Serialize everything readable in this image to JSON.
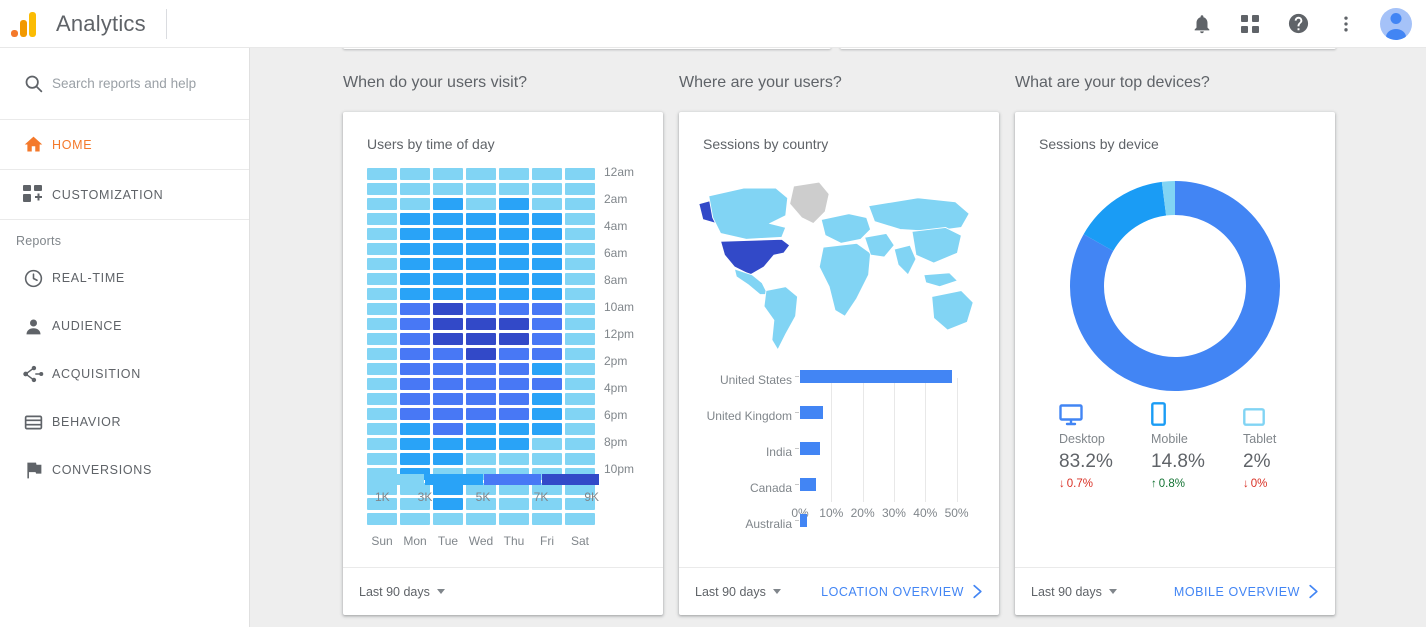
{
  "header": {
    "app_title": "Analytics",
    "logo_name": "google-analytics-logo",
    "icons": [
      {
        "name": "notifications-bell-icon",
        "label": "Notifications"
      },
      {
        "name": "apps-grid-icon",
        "label": "Google apps"
      },
      {
        "name": "help-circle-icon",
        "label": "Help"
      },
      {
        "name": "more-vert-icon",
        "label": "More options"
      },
      {
        "name": "avatar",
        "label": "Account"
      }
    ]
  },
  "sidebar": {
    "search": {
      "placeholder": "Search reports and help",
      "value": "",
      "icon": "search-icon"
    },
    "top_items": [
      {
        "label": "HOME",
        "icon": "home-icon",
        "active": true
      },
      {
        "label": "CUSTOMIZATION",
        "icon": "customization-icon",
        "active": false
      }
    ],
    "section_label": "Reports",
    "items": [
      {
        "label": "REAL-TIME",
        "icon": "clock-icon"
      },
      {
        "label": "AUDIENCE",
        "icon": "person-icon"
      },
      {
        "label": "ACQUISITION",
        "icon": "acquisition-icon"
      },
      {
        "label": "BEHAVIOR",
        "icon": "behavior-icon"
      },
      {
        "label": "CONVERSIONS",
        "icon": "flag-icon"
      }
    ]
  },
  "columns": {
    "header_1": "When do your users visit?",
    "header_2": "Where are your users?",
    "header_3": "What are your top devices?"
  },
  "cards": {
    "time_of_day": {
      "title": "Users by time of day",
      "date_range": "Last 90 days",
      "link": null
    },
    "country": {
      "title": "Sessions by country",
      "date_range": "Last 90 days",
      "link": "LOCATION OVERVIEW"
    },
    "device": {
      "title": "Sessions by device",
      "date_range": "Last 90 days",
      "link": "MOBILE OVERVIEW"
    }
  },
  "colors": {
    "accent_blue": "#4285F4",
    "heat_1": "#81D4F4",
    "heat_2": "#29A3F7",
    "heat_3": "#4878F5",
    "heat_4": "#3249C8",
    "brand_orange": "#F4792B",
    "up_green": "#137333",
    "down_red": "#D93025",
    "page_bg": "#EEEEEE",
    "map_default": "#81D4F4",
    "map_nodata": "#CDCDCD"
  },
  "chart_data": [
    {
      "type": "heatmap",
      "title": "Users by time of day",
      "xlabel": "",
      "ylabel": "",
      "categories": [
        "Sun",
        "Mon",
        "Tue",
        "Wed",
        "Thu",
        "Fri",
        "Sat"
      ],
      "y_tick_labels": [
        "12am",
        "2am",
        "4am",
        "6am",
        "8am",
        "10am",
        "12pm",
        "2pm",
        "4pm",
        "6pm",
        "8pm",
        "10pm"
      ],
      "rows": 24,
      "legend": {
        "bins": [
          "1K",
          "3K",
          "5K",
          "7K",
          "9K"
        ],
        "colors": [
          "#81D4F4",
          "#29A3F7",
          "#4878F5",
          "#3249C8"
        ]
      },
      "levels": [
        [
          1,
          1,
          1,
          1,
          1,
          1,
          1
        ],
        [
          1,
          1,
          1,
          1,
          1,
          1,
          1
        ],
        [
          1,
          1,
          2,
          1,
          2,
          1,
          1
        ],
        [
          1,
          2,
          2,
          2,
          2,
          2,
          1
        ],
        [
          1,
          2,
          2,
          2,
          2,
          2,
          1
        ],
        [
          1,
          2,
          2,
          2,
          2,
          2,
          1
        ],
        [
          1,
          2,
          2,
          2,
          2,
          2,
          1
        ],
        [
          1,
          2,
          2,
          2,
          2,
          2,
          1
        ],
        [
          1,
          2,
          2,
          2,
          2,
          2,
          1
        ],
        [
          1,
          3,
          4,
          3,
          3,
          3,
          1
        ],
        [
          1,
          3,
          4,
          4,
          4,
          3,
          1
        ],
        [
          1,
          3,
          4,
          4,
          4,
          3,
          1
        ],
        [
          1,
          3,
          3,
          4,
          3,
          3,
          1
        ],
        [
          1,
          3,
          3,
          3,
          3,
          2,
          1
        ],
        [
          1,
          3,
          3,
          3,
          3,
          3,
          1
        ],
        [
          1,
          3,
          3,
          3,
          3,
          2,
          1
        ],
        [
          1,
          3,
          3,
          3,
          3,
          2,
          1
        ],
        [
          1,
          2,
          3,
          2,
          2,
          2,
          1
        ],
        [
          1,
          2,
          2,
          2,
          2,
          1,
          1
        ],
        [
          1,
          2,
          2,
          1,
          1,
          1,
          1
        ],
        [
          1,
          2,
          1,
          1,
          1,
          1,
          1
        ],
        [
          1,
          1,
          2,
          1,
          1,
          1,
          1
        ],
        [
          1,
          1,
          2,
          1,
          1,
          1,
          1
        ],
        [
          1,
          1,
          1,
          1,
          1,
          1,
          1
        ]
      ]
    },
    {
      "type": "bar",
      "orientation": "horizontal",
      "title": "Sessions by country",
      "categories": [
        "United States",
        "United Kingdom",
        "India",
        "Canada",
        "Australia"
      ],
      "values": [
        48.5,
        7.5,
        6.5,
        5.2,
        2.3
      ],
      "xlabel": "",
      "ylabel": "",
      "xlim": [
        0,
        53
      ],
      "x_tick_labels": [
        "0%",
        "10%",
        "20%",
        "30%",
        "40%",
        "50%"
      ],
      "x_ticks": [
        0,
        10,
        20,
        30,
        40,
        50
      ],
      "grid": true,
      "series_color": "#4285F4",
      "map": {
        "highlighted": [
          {
            "country": "United States",
            "color": "#3249C8"
          },
          {
            "country": "Canada",
            "color": "#81D4F4"
          }
        ],
        "no_data": [
          "Greenland"
        ]
      }
    },
    {
      "type": "pie",
      "variant": "donut",
      "title": "Sessions by device",
      "labels": [
        "Desktop",
        "Mobile",
        "Tablet"
      ],
      "values": [
        83.2,
        14.8,
        2.0
      ],
      "colors": [
        "#4285F4",
        "#1A9CF5",
        "#81D4F4"
      ],
      "legend": "below",
      "deltas": [
        "0.7%",
        "0.8%",
        "0%"
      ],
      "delta_directions": [
        "down",
        "up",
        "down"
      ]
    }
  ],
  "devices": [
    {
      "name": "Desktop",
      "value": "83.2%",
      "delta": "0.7%",
      "direction": "down",
      "icon": "desktop-icon",
      "color": "#4285F4"
    },
    {
      "name": "Mobile",
      "value": "14.8%",
      "delta": "0.8%",
      "direction": "up",
      "icon": "mobile-icon",
      "color": "#1A9CF5"
    },
    {
      "name": "Tablet",
      "value": "2%",
      "delta": "0%",
      "direction": "down",
      "icon": "tablet-icon",
      "color": "#81D4F4"
    }
  ]
}
